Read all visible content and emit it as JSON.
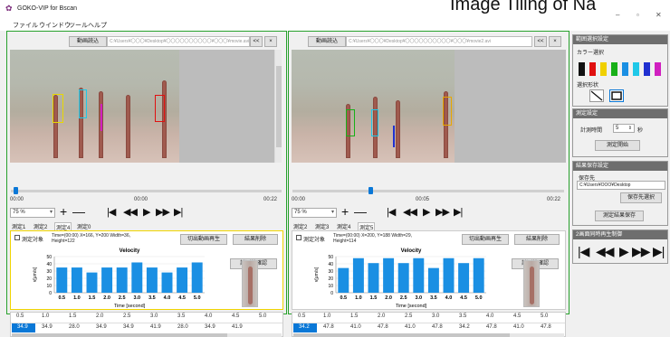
{
  "window": {
    "title": "GOKO-VIP for Bscan",
    "watermark": "Image Tiling of Na",
    "controls": [
      "–",
      "▫",
      "✕"
    ]
  },
  "menu": [
    "ファイル",
    "ウインドウ",
    "ツール",
    "ヘルプ"
  ],
  "panes": [
    {
      "load_label": "動画読込",
      "path": "C:¥Users¥〇〇〇¥Desktop¥〇〇〇〇〇〇〇〇〇〇¥〇〇〇¥movie.avi",
      "back_label": "<<",
      "close_label": "×",
      "time_start": "00:00",
      "time_current": "00:00",
      "time_end": "00:22",
      "zoom": "75 %",
      "tabs": [
        "測定1",
        "測定2",
        "測定4",
        "測定0"
      ],
      "active_tab": 2,
      "measure_target_label": "測定対象",
      "meta_line1": "Time=(00:00) X=166, Y=200 Width=36,",
      "meta_line2": "Height=122",
      "clip_play_label": "切出動画再生",
      "delete_result_label": "結果削除",
      "confirm_line_label": "計測線確認",
      "chart_title": "Velocity",
      "ylabel": "v[μm/s]",
      "xlabel": "Time [second]",
      "table_header": [
        "0.5",
        "1.0",
        "1.5",
        "2.0",
        "2.5",
        "3.0",
        "3.5",
        "4.0",
        "4.5",
        "5.0"
      ],
      "table_values": [
        "34.9",
        "34.9",
        "28.0",
        "34.9",
        "34.9",
        "41.9",
        "28.0",
        "34.9",
        "41.9"
      ]
    },
    {
      "load_label": "動画読込",
      "path": "C:¥Users¥〇〇〇¥Desktop¥〇〇〇〇〇〇〇〇〇〇¥〇〇〇¥movie2.avi",
      "back_label": "<<",
      "close_label": "×",
      "time_start": "00:00",
      "time_current": "00:05",
      "time_end": "00:22",
      "zoom": "75 %",
      "tabs": [
        "測定2",
        "測定3",
        "測定4",
        "測定5"
      ],
      "active_tab": 3,
      "measure_target_label": "測定対象",
      "meta_line1": "Time=(00:00) X=200, Y=188 Width=29,",
      "meta_line2": "Height=114",
      "clip_play_label": "切出動画再生",
      "delete_result_label": "結果削除",
      "confirm_line_label": "計測線確認",
      "chart_title": "Velocity",
      "ylabel": "v[μm/s]",
      "xlabel": "Time [second]",
      "table_header": [
        "0.5",
        "1.0",
        "1.5",
        "2.0",
        "2.5",
        "3.0",
        "3.5",
        "4.0",
        "4.5",
        "5.0"
      ],
      "table_values": [
        "34.2",
        "47.8",
        "41.0",
        "47.8",
        "41.0",
        "47.8",
        "34.2",
        "47.8",
        "41.0",
        "47.8"
      ]
    }
  ],
  "chart_data": [
    {
      "type": "bar",
      "title": "Velocity",
      "xlabel": "Time [second]",
      "ylabel": "v[μm/s]",
      "categories": [
        "0.5",
        "1.0",
        "1.5",
        "2.0",
        "2.5",
        "3.0",
        "3.5",
        "4.0",
        "4.5",
        "5.0"
      ],
      "values": [
        34.9,
        34.9,
        28.0,
        34.9,
        34.9,
        41.9,
        34.9,
        28.0,
        34.9,
        41.9
      ],
      "yticks": [
        "0",
        "10",
        "20",
        "30",
        "40",
        "50"
      ],
      "ylim": [
        0,
        50
      ],
      "color": "#1a8fe3"
    },
    {
      "type": "bar",
      "title": "Velocity",
      "xlabel": "Time [second]",
      "ylabel": "v[μm/s]",
      "categories": [
        "0.5",
        "1.0",
        "1.5",
        "2.0",
        "2.5",
        "3.0",
        "3.5",
        "4.0",
        "4.5",
        "5.0"
      ],
      "values": [
        34.2,
        47.8,
        41.0,
        47.8,
        41.0,
        47.8,
        34.2,
        47.8,
        41.0,
        47.8
      ],
      "yticks": [
        "0",
        "10",
        "20",
        "30",
        "40",
        "50"
      ],
      "ylim": [
        0,
        50
      ],
      "color": "#1a8fe3"
    }
  ],
  "side": {
    "area_header": "範囲選択設定",
    "color_label": "カラー選択",
    "colors": [
      "#111111",
      "#e01010",
      "#f0d000",
      "#18b018",
      "#1a8fe3",
      "#20c8e8",
      "#2030d0",
      "#d020c0"
    ],
    "shape_label": "選択形状",
    "measure_header": "測定設定",
    "measure_time_label": "計測時間",
    "measure_time_value": "5",
    "measure_time_unit": "秒",
    "start_label": "測定開始",
    "save_header": "結果保存設定",
    "save_dir_label": "保存先",
    "save_dir_value": "C:¥Users¥OOO¥Desktop",
    "choose_dir_label": "保存先選択",
    "save_result_label": "測定結果保存",
    "sync_header": "2画面同時再生制御"
  }
}
